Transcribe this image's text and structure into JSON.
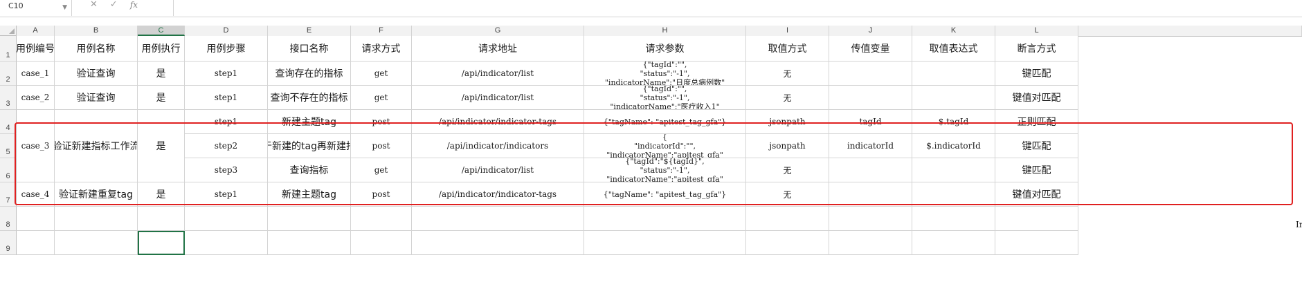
{
  "formula_bar": {
    "name_box": "C10",
    "cancel_icon": "✕",
    "confirm_icon": "✓",
    "fx_label": "fx",
    "formula": ""
  },
  "columns": [
    "A",
    "B",
    "C",
    "D",
    "E",
    "F",
    "G",
    "H",
    "I",
    "J",
    "K",
    "L"
  ],
  "row_numbers": [
    "1",
    "2",
    "3",
    "4",
    "5",
    "6",
    "7",
    "8",
    "9"
  ],
  "headers": [
    "用例编号",
    "用例名称",
    "用例执行",
    "用例步骤",
    "接口名称",
    "请求方式",
    "请求地址",
    "请求参数",
    "取值方式",
    "传值变量",
    "取值表达式",
    "断言方式"
  ],
  "rows": [
    {
      "id": "case_1",
      "name": "验证查询",
      "exec": "是",
      "step": "step1",
      "api": "查询存在的指标",
      "method": "get",
      "url": "/api/indicator/list",
      "params": "{\"tagId\":\"\",\n\"status\":\"-1\",\n\"indicatorName\":\"日度总病例数\"",
      "extract": "无",
      "var": "",
      "expr": "",
      "assert": "键匹配"
    },
    {
      "id": "case_2",
      "name": "验证查询",
      "exec": "是",
      "step": "step1",
      "api": "查询不存在的指标",
      "method": "get",
      "url": "/api/indicator/list",
      "params": "{\"tagId\":\"\",\n\"status\":\"-1\",\n\"indicatorName\":\"医疗收入1\"",
      "extract": "无",
      "var": "",
      "expr": "",
      "assert": "键值对匹配"
    },
    {
      "id": "case_3",
      "name": "验证新建指标工作流",
      "exec": "是",
      "step": "step1",
      "api": "新建主题tag",
      "method": "post",
      "url": "/api/indicator/indicator-tags",
      "params": "{\"tagName\": \"apitest_tag_gfa\"}",
      "extract": "jsonpath",
      "var": "tagId",
      "expr": "$.tagId",
      "assert": "正则匹配"
    },
    {
      "id": "",
      "name": "",
      "exec": "",
      "step": "step2",
      "api": "基于新建的tag再新建指标",
      "method": "post",
      "url": "/api/indicator/indicators",
      "params": "{\n\"indicatorId\":\"\",\n\"indicatorName\":\"apitest_gfa\"",
      "extract": "jsonpath",
      "var": "indicatorId",
      "expr": "$.indicatorId",
      "assert": "键匹配"
    },
    {
      "id": "",
      "name": "",
      "exec": "",
      "step": "step3",
      "api": "查询指标",
      "method": "get",
      "url": "/api/indicator/list",
      "params": "{\"tagId\":\"${tagId}\",\n\"status\":\"-1\",\n\"indicatorName\":\"apitest_gfa\"",
      "extract": "无",
      "var": "",
      "expr": "",
      "assert": "键匹配"
    },
    {
      "id": "case_4",
      "name": "验证新建重复tag",
      "exec": "是",
      "step": "step1",
      "api": "新建主题tag",
      "method": "post",
      "url": "/api/indicator/indicator-tags",
      "params": "{\"tagName\": \"apitest_tag_gfa\"}",
      "extract": "无",
      "var": "",
      "expr": "",
      "assert": "键值对匹配"
    }
  ],
  "overflow_text": "In",
  "colors": {
    "accent": "#217346",
    "highlight": "#e02020",
    "grid": "#d4d4d4",
    "header_bg": "#f2f2f2"
  }
}
